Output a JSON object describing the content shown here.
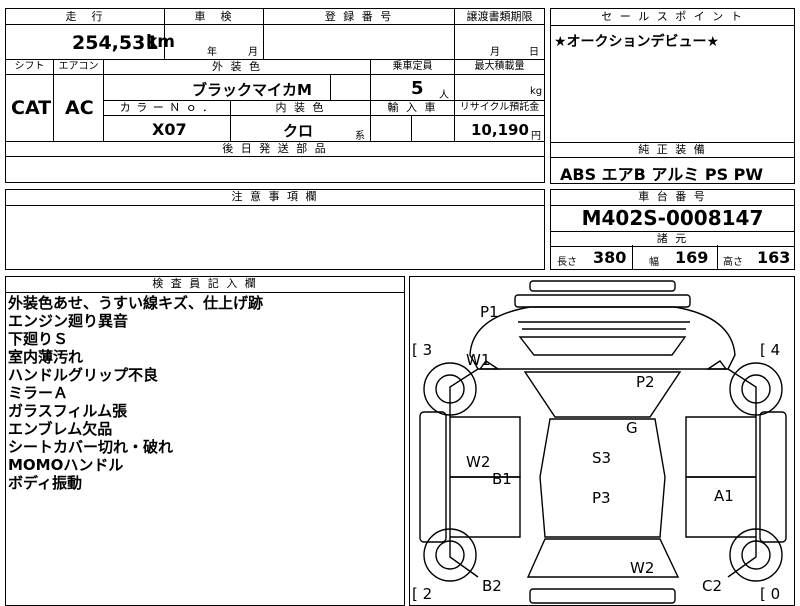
{
  "top_fragment": "",
  "mileage": {
    "label": "走　行",
    "value": "254,531",
    "unit": "km"
  },
  "inspection": {
    "label": "車　検",
    "year_unit": "年",
    "month_unit": "月"
  },
  "registration": {
    "label": "登 録 番 号",
    "value": ""
  },
  "transfer": {
    "label": "譲渡書類期限",
    "month_unit": "月",
    "day_unit": "日"
  },
  "sales_point": {
    "label": "セ ー ル ス ポ イ ン ト",
    "text": "★オークションデビュー★"
  },
  "shift": {
    "label": "シフト",
    "value": "CAT"
  },
  "aircon": {
    "label": "エアコン",
    "value": "AC"
  },
  "exterior_color": {
    "label": "外 装 色",
    "value": "ブラックマイカM"
  },
  "capacity": {
    "label": "乗車定員",
    "value": "5",
    "unit": "人"
  },
  "max_load": {
    "label": "最大積載量",
    "unit": "kg"
  },
  "color_no": {
    "label": "カ ラ ー Ｎ ｏ ．",
    "value": "X07"
  },
  "interior_color": {
    "label": "内 装 色",
    "value": "クロ",
    "suffix": "系"
  },
  "import": {
    "label": "輸 入 車"
  },
  "recycle": {
    "label": "リサイクル預託金",
    "value": "10,190",
    "unit": "円"
  },
  "later_parts": {
    "label": "後 日 発 送 部 品"
  },
  "equipment": {
    "label": "純 正 装 備",
    "value": "ABS エアB アルミ PS PW"
  },
  "notes": {
    "label": "注 意 事 項 欄"
  },
  "chassis": {
    "label": "車 台 番 号",
    "value": "M402S-0008147"
  },
  "specs": {
    "label": "諸 元",
    "length_label": "長さ",
    "length": "380",
    "width_label": "幅",
    "width": "169",
    "height_label": "高さ",
    "height": "163"
  },
  "inspector": {
    "label": "検 査 員 記 入 欄",
    "lines": [
      "外装色あせ、うすい線キズ、仕上げ跡",
      "エンジン廻り異音",
      "下廻りＳ",
      "室内薄汚れ",
      "ハンドルグリップ不良",
      "ミラーＡ",
      "ガラスフィルム張",
      "エンブレム欠品",
      "シートカバー切れ・破れ",
      "MOMOハンドル",
      "ボディ振動"
    ]
  },
  "diagram": {
    "marks": {
      "p1": "P1",
      "w1": "W1",
      "p2": "P2",
      "g": "G",
      "w2_left": "W2",
      "b1": "B1",
      "s3": "S3",
      "p3": "P3",
      "a1": "A1",
      "w2_bottom": "W2",
      "b2": "B2",
      "c2": "C2"
    },
    "corners": {
      "tl": "[ 3",
      "tr": "[ 4",
      "bl": "[ 2",
      "br": "[ 0"
    }
  }
}
